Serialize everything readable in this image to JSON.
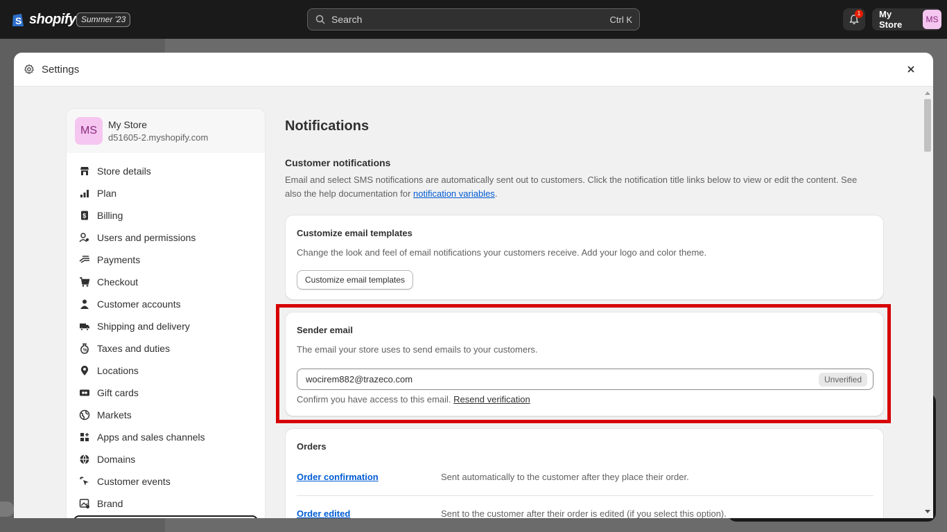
{
  "topbar": {
    "logo_text": "shopify",
    "edition": "Summer '23",
    "search_placeholder": "Search",
    "search_shortcut": "Ctrl K",
    "notification_count": "1",
    "store_name": "My Store",
    "store_initials": "MS"
  },
  "modal": {
    "title": "Settings"
  },
  "sidebar": {
    "store": {
      "initials": "MS",
      "name": "My Store",
      "domain": "d51605-2.myshopify.com"
    },
    "items": [
      {
        "label": "Store details",
        "icon": "store-icon"
      },
      {
        "label": "Plan",
        "icon": "plan-icon"
      },
      {
        "label": "Billing",
        "icon": "billing-icon"
      },
      {
        "label": "Users and permissions",
        "icon": "users-icon"
      },
      {
        "label": "Payments",
        "icon": "payments-icon"
      },
      {
        "label": "Checkout",
        "icon": "cart-icon"
      },
      {
        "label": "Customer accounts",
        "icon": "person-icon"
      },
      {
        "label": "Shipping and delivery",
        "icon": "truck-icon"
      },
      {
        "label": "Taxes and duties",
        "icon": "tax-icon"
      },
      {
        "label": "Locations",
        "icon": "location-icon"
      },
      {
        "label": "Gift cards",
        "icon": "gift-card-icon"
      },
      {
        "label": "Markets",
        "icon": "globe-icon"
      },
      {
        "label": "Apps and sales channels",
        "icon": "apps-icon"
      },
      {
        "label": "Domains",
        "icon": "domain-icon"
      },
      {
        "label": "Customer events",
        "icon": "events-icon"
      },
      {
        "label": "Brand",
        "icon": "brand-icon"
      }
    ]
  },
  "content": {
    "page_title": "Notifications",
    "section_title": "Customer notifications",
    "section_desc_before": "Email and select SMS notifications are automatically sent out to customers. Click the notification title links below to view or edit the content. See also the help documentation for ",
    "section_desc_link": "notification variables",
    "section_desc_after": ".",
    "templates_card": {
      "title": "Customize email templates",
      "text": "Change the look and feel of email notifications your customers receive. Add your logo and color theme.",
      "button": "Customize email templates"
    },
    "sender_card": {
      "title": "Sender email",
      "text": "The email your store uses to send emails to your customers.",
      "email": "wocirem882@trazeco.com",
      "status": "Unverified",
      "confirm_text": "Confirm you have access to this email.",
      "resend_link": "Resend verification"
    },
    "orders_card": {
      "title": "Orders",
      "rows": [
        {
          "link": "Order confirmation",
          "desc": "Sent automatically to the customer after they place their order."
        },
        {
          "link": "Order edited",
          "desc": "Sent to the customer after their order is edited (if you select this option)."
        }
      ]
    }
  },
  "colors": {
    "topbar": "#1a1a1a",
    "link": "#005bd3",
    "highlight": "#d60000",
    "avatar": "#f5c6f0"
  }
}
